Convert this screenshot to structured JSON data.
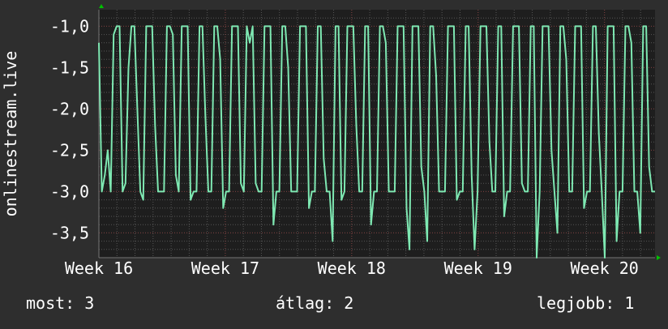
{
  "chart_data": {
    "type": "line",
    "ylabel": "onlinestream.live",
    "ylim": [
      -3.8,
      -0.8
    ],
    "yticks": [
      "-1,0",
      "-1,5",
      "-2,0",
      "-2,5",
      "-3,0",
      "-3,5"
    ],
    "ytick_values": [
      -1.0,
      -1.5,
      -2.0,
      -2.5,
      -3.0,
      -3.5
    ],
    "xtick_labels": [
      "Week 16",
      "Week 17",
      "Week 18",
      "Week 19",
      "Week 20"
    ],
    "xlim": [
      0,
      4.4
    ],
    "grid": true,
    "colors": {
      "background": "#2e2e2e",
      "plot_background": "#1e1e1e",
      "line": "#7ee8b2",
      "grid_major": "#7a3a3a",
      "grid_minor": "#555555",
      "axis_text": "#ffffff",
      "axis_arrow": "#00c000"
    },
    "series": [
      {
        "values": [
          -1.2,
          -3.0,
          -2.8,
          -2.5,
          -3.0,
          -1.1,
          -1.0,
          -1.0,
          -3.0,
          -2.9,
          -1.5,
          -1.0,
          -1.0,
          -2.0,
          -3.0,
          -3.1,
          -1.0,
          -1.0,
          -1.0,
          -2.2,
          -3.0,
          -3.0,
          -3.0,
          -1.0,
          -1.0,
          -1.1,
          -2.8,
          -3.0,
          -1.0,
          -1.0,
          -1.0,
          -3.1,
          -3.0,
          -3.0,
          -1.0,
          -1.0,
          -2.1,
          -3.0,
          -3.0,
          -1.0,
          -1.0,
          -1.4,
          -3.2,
          -3.0,
          -3.0,
          -1.0,
          -1.0,
          -1.0,
          -2.9,
          -3.0,
          -1.0,
          -1.2,
          -1.0,
          -2.9,
          -3.0,
          -3.0,
          -1.0,
          -1.0,
          -1.0,
          -3.4,
          -3.0,
          -3.0,
          -1.0,
          -1.0,
          -1.5,
          -3.0,
          -3.0,
          -3.0,
          -1.0,
          -1.0,
          -1.0,
          -3.2,
          -3.0,
          -3.0,
          -1.0,
          -1.0,
          -2.6,
          -3.0,
          -3.0,
          -3.6,
          -1.0,
          -1.0,
          -3.1,
          -3.0,
          -1.0,
          -1.0,
          -1.0,
          -2.2,
          -3.0,
          -3.0,
          -1.0,
          -1.0,
          -3.4,
          -3.0,
          -3.0,
          -1.0,
          -1.0,
          -1.2,
          -3.0,
          -3.0,
          -3.0,
          -1.0,
          -1.0,
          -1.0,
          -3.2,
          -3.7,
          -1.0,
          -1.0,
          -1.0,
          -2.7,
          -3.0,
          -3.6,
          -1.0,
          -1.0,
          -1.6,
          -3.0,
          -3.0,
          -3.0,
          -1.0,
          -1.0,
          -1.0,
          -3.1,
          -3.0,
          -3.0,
          -1.0,
          -1.0,
          -2.8,
          -3.7,
          -3.0,
          -1.0,
          -1.0,
          -1.0,
          -2.4,
          -3.0,
          -3.0,
          -1.0,
          -1.0,
          -3.3,
          -3.0,
          -3.0,
          -1.0,
          -1.0,
          -1.0,
          -2.9,
          -3.0,
          -3.0,
          -1.0,
          -1.0,
          -3.8,
          -3.0,
          -1.0,
          -1.0,
          -1.0,
          -2.5,
          -3.0,
          -3.5,
          -1.0,
          -1.0,
          -1.4,
          -3.0,
          -3.0,
          -1.0,
          -1.0,
          -1.0,
          -3.2,
          -3.0,
          -3.0,
          -1.0,
          -1.0,
          -2.3,
          -3.0,
          -3.8,
          -1.0,
          -1.0,
          -1.0,
          -3.6,
          -3.0,
          -3.0,
          -1.0,
          -1.0,
          -1.2,
          -3.0,
          -3.0,
          -3.5,
          -1.0,
          -1.0,
          -2.7,
          -3.0,
          -3.0
        ]
      }
    ]
  },
  "footer": {
    "now_label": "most:",
    "now_value": "3",
    "avg_label": "átlag:",
    "avg_value": "2",
    "best_label": "legjobb:",
    "best_value": "1"
  }
}
